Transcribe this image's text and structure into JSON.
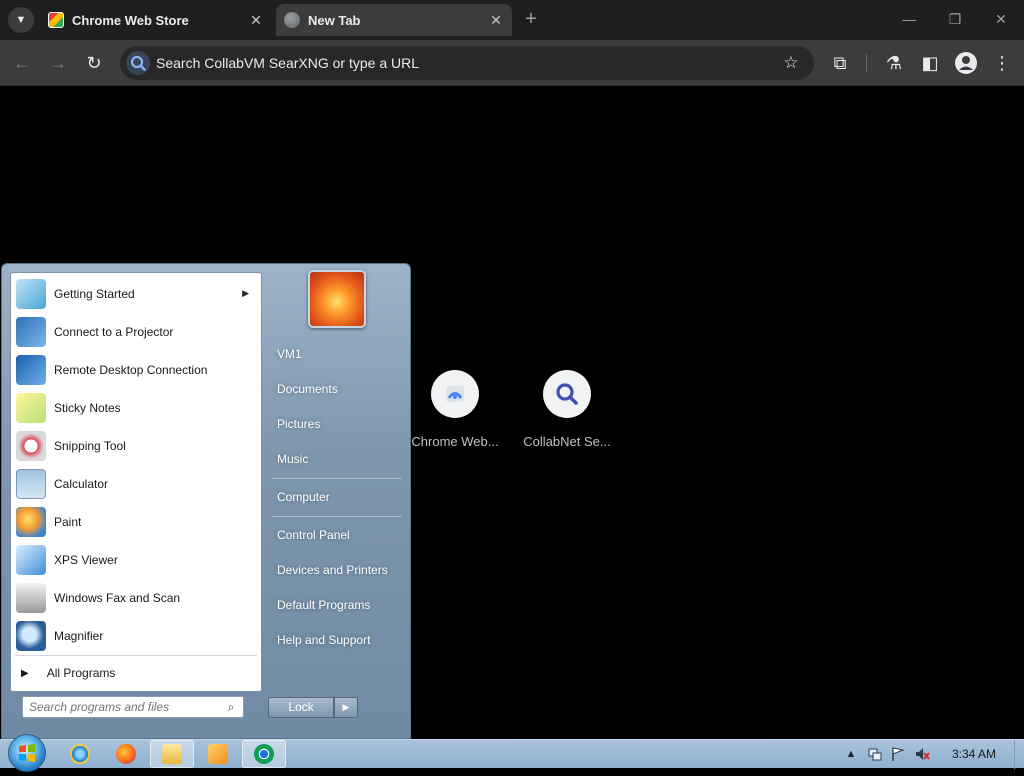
{
  "browser": {
    "tabs": [
      {
        "title": "Chrome Web Store",
        "icon": "chrome-web-store-icon"
      },
      {
        "title": "New Tab",
        "icon": "globe-icon"
      }
    ],
    "new_tab_symbol": "+",
    "close_symbol": "✕",
    "window_controls": {
      "minimize": "—",
      "restore": "❐",
      "close": "✕"
    }
  },
  "toolbar": {
    "omnibox_text": "Search CollabVM SearXNG or type a URL",
    "back_symbol": "←",
    "forward_symbol": "→",
    "reload_symbol": "↻",
    "star_symbol": "☆",
    "extensions_symbol": "⧉",
    "labs_symbol": "⚗",
    "sidepanel_symbol": "◧",
    "profile_symbol": "●",
    "menu_symbol": "⋮"
  },
  "newtab": {
    "shortcuts": [
      {
        "label": "Chrome Web..."
      },
      {
        "label": "CollabNet Se..."
      }
    ]
  },
  "start_menu": {
    "programs": [
      {
        "label": "Getting Started",
        "has_submenu": true
      },
      {
        "label": "Connect to a Projector"
      },
      {
        "label": "Remote Desktop Connection"
      },
      {
        "label": "Sticky Notes"
      },
      {
        "label": "Snipping Tool"
      },
      {
        "label": "Calculator"
      },
      {
        "label": "Paint"
      },
      {
        "label": "XPS Viewer"
      },
      {
        "label": "Windows Fax and Scan"
      },
      {
        "label": "Magnifier"
      }
    ],
    "all_programs": "All Programs",
    "search_placeholder": "Search programs and files",
    "right_links": [
      "VM1",
      "Documents",
      "Pictures",
      "Music",
      "Computer",
      "Control Panel",
      "Devices and Printers",
      "Default Programs",
      "Help and Support"
    ],
    "lock_label": "Lock",
    "lock_arrow": "▶"
  },
  "taskbar": {
    "clock": "3:34 AM",
    "tray_up": "▲"
  }
}
